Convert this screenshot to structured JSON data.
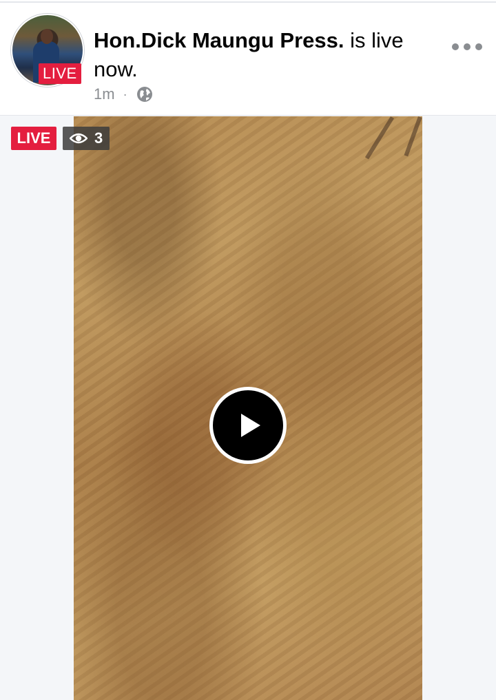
{
  "post": {
    "author": "Hon.Dick Maungu Press.",
    "status_text": " is live now.",
    "timestamp": "1m",
    "separator": "·",
    "avatar_badge": "LIVE",
    "privacy_icon": "globe-icon",
    "menu_icon": "more-options-icon"
  },
  "video": {
    "live_label": "LIVE",
    "viewer_count": "3",
    "viewer_icon": "eye-icon",
    "play_icon": "play-icon"
  },
  "colors": {
    "live_red": "#e41e3f",
    "meta_gray": "#8a8d91",
    "text_black": "#050505"
  }
}
